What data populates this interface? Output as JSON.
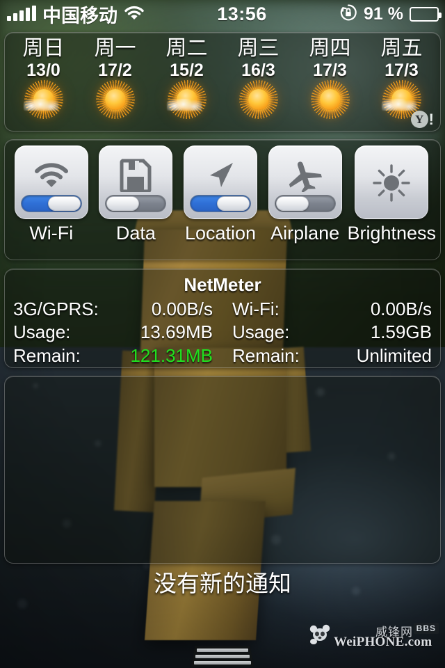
{
  "status_bar": {
    "signal_bars": 5,
    "carrier": "中国移动",
    "wifi_icon": "wifi-icon",
    "time": "13:56",
    "rotation_lock_icon": "rotation-lock-icon",
    "battery_percent": "91 %",
    "battery_icon": "battery-icon"
  },
  "weather": {
    "provider_logo": "yahoo-logo",
    "provider_letter": "Y",
    "provider_mark": "!",
    "days": [
      {
        "name": "周日",
        "temps": "13/0",
        "icon": "sun-cloud-icon"
      },
      {
        "name": "周一",
        "temps": "17/2",
        "icon": "sun-icon"
      },
      {
        "name": "周二",
        "temps": "15/2",
        "icon": "sun-cloud-icon"
      },
      {
        "name": "周三",
        "temps": "16/3",
        "icon": "sun-icon"
      },
      {
        "name": "周四",
        "temps": "17/3",
        "icon": "sun-icon"
      },
      {
        "name": "周五",
        "temps": "17/3",
        "icon": "sun-cloud-icon"
      }
    ]
  },
  "toggles": [
    {
      "label": "Wi-Fi",
      "icon": "wifi-icon",
      "state": "on",
      "has_switch": true
    },
    {
      "label": "Data",
      "icon": "floppy-disk-icon",
      "state": "off",
      "has_switch": true
    },
    {
      "label": "Location",
      "icon": "location-arrow-icon",
      "state": "on",
      "has_switch": true
    },
    {
      "label": "Airplane",
      "icon": "airplane-icon",
      "state": "off",
      "has_switch": true
    },
    {
      "label": "Brightness",
      "icon": "sun-brightness-icon",
      "state": "none",
      "has_switch": false
    }
  ],
  "netmeter": {
    "title": "NetMeter",
    "left": {
      "speed_label": "3G/GPRS:",
      "speed_value": "0.00B/s",
      "usage_label": "Usage:",
      "usage_value": "13.69MB",
      "remain_label": "Remain:",
      "remain_value": "121.31MB",
      "remain_color": "#20e11f"
    },
    "right": {
      "speed_label": "Wi-Fi:",
      "speed_value": "0.00B/s",
      "usage_label": "Usage:",
      "usage_value": "1.59GB",
      "remain_label": "Remain:",
      "remain_value": "Unlimited"
    }
  },
  "notifications": {
    "empty_text": "没有新的通知"
  },
  "watermark": {
    "cn_name": "威锋网",
    "badge": "BBS",
    "site": "WeiPHONE.com"
  },
  "grabber": {
    "name": "pull-handle"
  },
  "colors": {
    "switch_on": "#2f6fd6",
    "switch_off": "#7d838e",
    "highlight_green": "#20e11f",
    "panel_bg": "rgba(14,18,14,.42)"
  }
}
